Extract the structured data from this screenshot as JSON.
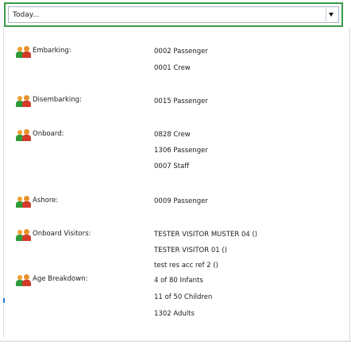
{
  "date_filter": {
    "selected": "Today..."
  },
  "sections": [
    {
      "label": "Embarking:",
      "values": [
        "0002 Passenger",
        "0001 Crew"
      ]
    },
    {
      "label": "Disembarking:",
      "values": [
        "0015 Passenger"
      ]
    },
    {
      "label": "Onboard:",
      "values": [
        "0828 Crew",
        "1306 Passenger",
        "0007 Staff"
      ]
    },
    {
      "label": "Ashore:",
      "values": [
        "0009 Passenger"
      ]
    },
    {
      "label": "Onboard Visitors:",
      "values": [
        "TESTER VISITOR MUSTER 04 ()",
        "TESTER VISITOR 01 ()",
        "test res acc ref 2 ()"
      ]
    },
    {
      "label": "Age Breakdown:",
      "values": [
        "4 of 80 Infants",
        "11 of 50 Children",
        "1302 Adults"
      ]
    }
  ],
  "icons": {
    "section_icon": "people-group-icon",
    "dropdown": "chevron-down-icon"
  },
  "colors": {
    "focus_border": "#3a9a49",
    "person_green": "#2f9a3a",
    "person_red": "#d33a2a",
    "head_orange": "#f0a030"
  }
}
